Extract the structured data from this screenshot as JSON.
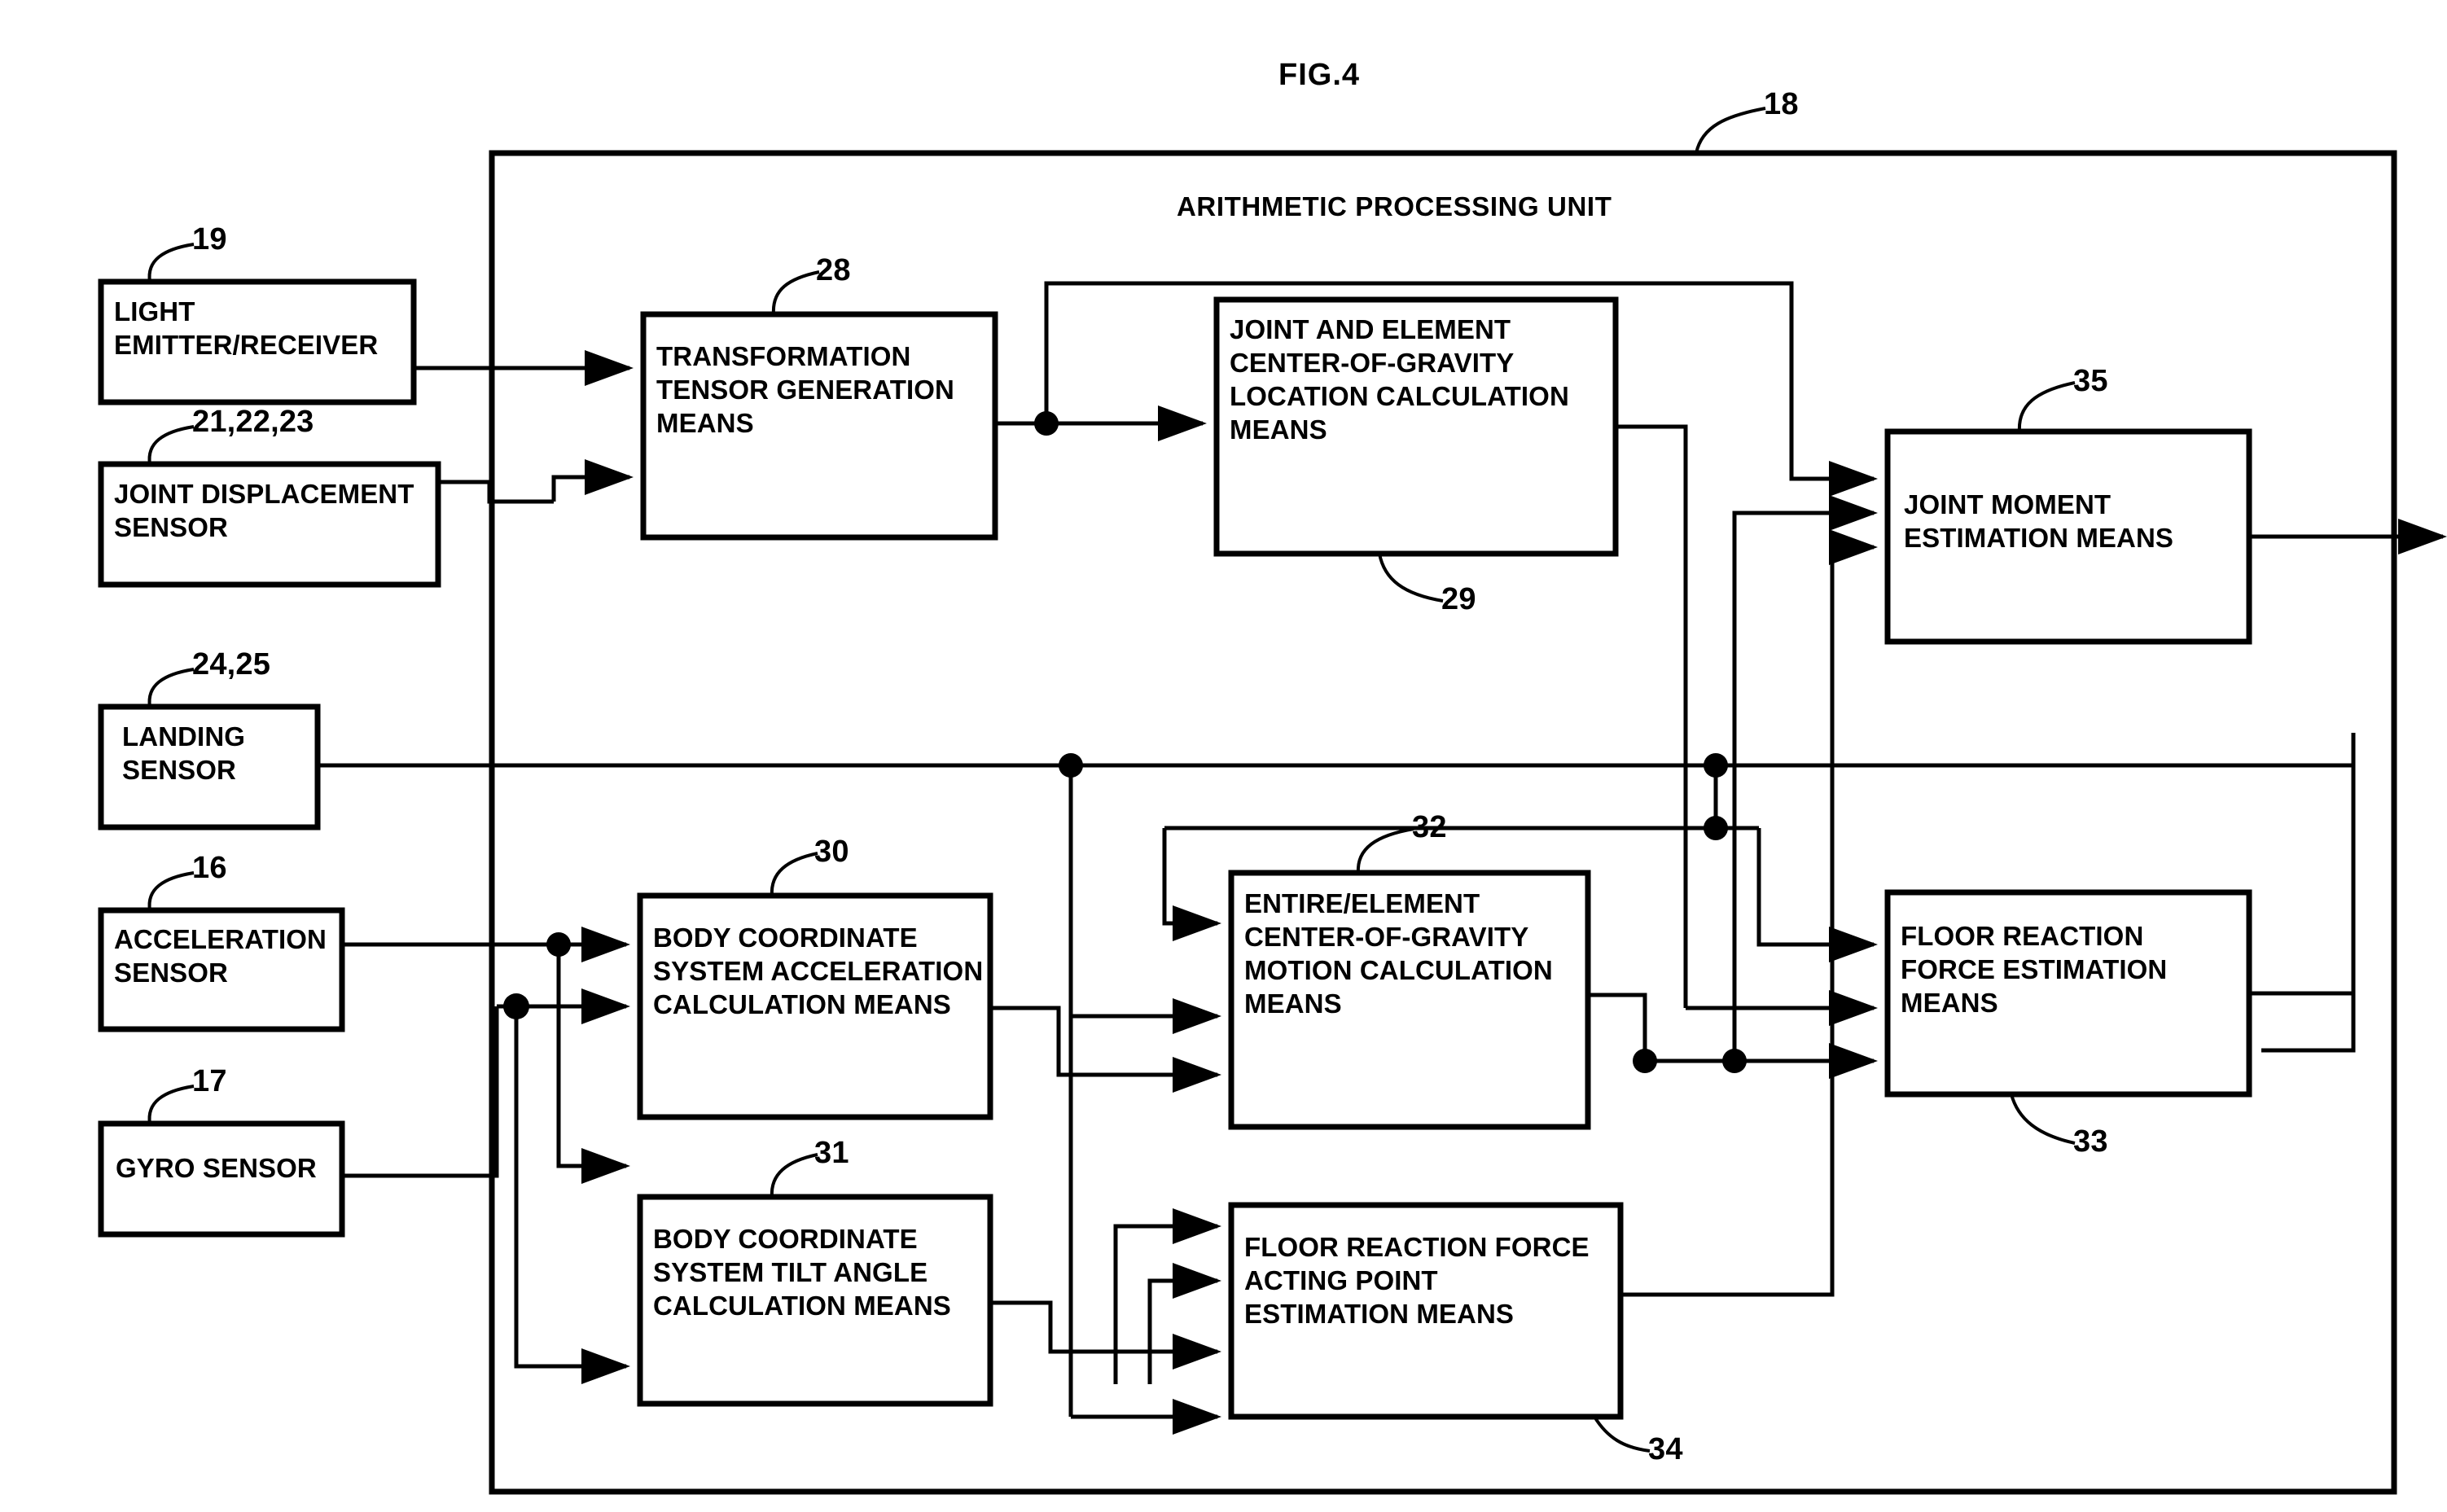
{
  "figure": {
    "title": "FIG.4",
    "container_label": "ARITHMETIC PROCESSING UNIT",
    "container_ref": "18"
  },
  "sensors": [
    {
      "ref": "19",
      "name": "light-emitter-receiver",
      "text": "LIGHT\nEMITTER/RECEIVER"
    },
    {
      "ref": "21,22,23",
      "name": "joint-displacement-sensor",
      "text": "JOINT DISPLACEMENT\nSENSOR"
    },
    {
      "ref": "24,25",
      "name": "landing-sensor",
      "text": "LANDING\nSENSOR"
    },
    {
      "ref": "16",
      "name": "acceleration-sensor",
      "text": "ACCELERATION\nSENSOR"
    },
    {
      "ref": "17",
      "name": "gyro-sensor",
      "text": "GYRO SENSOR"
    }
  ],
  "blocks": [
    {
      "ref": "28",
      "name": "transformation-tensor-generation-means",
      "text": "TRANSFORMATION\nTENSOR GENERATION\nMEANS"
    },
    {
      "ref": "29",
      "name": "joint-and-element-cog-location-calculation-means",
      "text": "JOINT AND ELEMENT\nCENTER-OF-GRAVITY\nLOCATION CALCULATION\nMEANS"
    },
    {
      "ref": "35",
      "name": "joint-moment-estimation-means",
      "text": "JOINT MOMENT\nESTIMATION MEANS"
    },
    {
      "ref": "30",
      "name": "body-coordinate-system-acceleration-calculation-means",
      "text": "BODY COORDINATE\nSYSTEM ACCELERATION\nCALCULATION MEANS"
    },
    {
      "ref": "32",
      "name": "entire-element-cog-motion-calculation-means",
      "text": "ENTIRE/ELEMENT\nCENTER-OF-GRAVITY\nMOTION CALCULATION\nMEANS"
    },
    {
      "ref": "33",
      "name": "floor-reaction-force-estimation-means",
      "text": "FLOOR REACTION\nFORCE ESTIMATION\nMEANS"
    },
    {
      "ref": "31",
      "name": "body-coordinate-system-tilt-angle-calculation-means",
      "text": "BODY COORDINATE\nSYSTEM TILT ANGLE\nCALCULATION MEANS"
    },
    {
      "ref": "34",
      "name": "floor-reaction-force-acting-point-estimation-means",
      "text": "FLOOR REACTION FORCE\nACTING POINT\nESTIMATION MEANS"
    }
  ],
  "colors": {
    "ink": "#000000",
    "paper": "#ffffff"
  }
}
